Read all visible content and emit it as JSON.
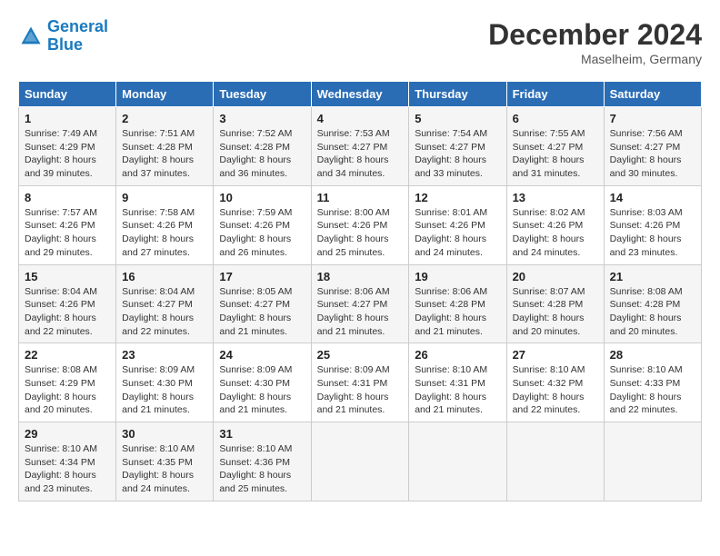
{
  "header": {
    "logo_general": "General",
    "logo_blue": "Blue",
    "month_title": "December 2024",
    "location": "Maselheim, Germany"
  },
  "days_of_week": [
    "Sunday",
    "Monday",
    "Tuesday",
    "Wednesday",
    "Thursday",
    "Friday",
    "Saturday"
  ],
  "weeks": [
    [
      {
        "day": "1",
        "sunrise": "Sunrise: 7:49 AM",
        "sunset": "Sunset: 4:29 PM",
        "daylight": "Daylight: 8 hours and 39 minutes."
      },
      {
        "day": "2",
        "sunrise": "Sunrise: 7:51 AM",
        "sunset": "Sunset: 4:28 PM",
        "daylight": "Daylight: 8 hours and 37 minutes."
      },
      {
        "day": "3",
        "sunrise": "Sunrise: 7:52 AM",
        "sunset": "Sunset: 4:28 PM",
        "daylight": "Daylight: 8 hours and 36 minutes."
      },
      {
        "day": "4",
        "sunrise": "Sunrise: 7:53 AM",
        "sunset": "Sunset: 4:27 PM",
        "daylight": "Daylight: 8 hours and 34 minutes."
      },
      {
        "day": "5",
        "sunrise": "Sunrise: 7:54 AM",
        "sunset": "Sunset: 4:27 PM",
        "daylight": "Daylight: 8 hours and 33 minutes."
      },
      {
        "day": "6",
        "sunrise": "Sunrise: 7:55 AM",
        "sunset": "Sunset: 4:27 PM",
        "daylight": "Daylight: 8 hours and 31 minutes."
      },
      {
        "day": "7",
        "sunrise": "Sunrise: 7:56 AM",
        "sunset": "Sunset: 4:27 PM",
        "daylight": "Daylight: 8 hours and 30 minutes."
      }
    ],
    [
      {
        "day": "8",
        "sunrise": "Sunrise: 7:57 AM",
        "sunset": "Sunset: 4:26 PM",
        "daylight": "Daylight: 8 hours and 29 minutes."
      },
      {
        "day": "9",
        "sunrise": "Sunrise: 7:58 AM",
        "sunset": "Sunset: 4:26 PM",
        "daylight": "Daylight: 8 hours and 27 minutes."
      },
      {
        "day": "10",
        "sunrise": "Sunrise: 7:59 AM",
        "sunset": "Sunset: 4:26 PM",
        "daylight": "Daylight: 8 hours and 26 minutes."
      },
      {
        "day": "11",
        "sunrise": "Sunrise: 8:00 AM",
        "sunset": "Sunset: 4:26 PM",
        "daylight": "Daylight: 8 hours and 25 minutes."
      },
      {
        "day": "12",
        "sunrise": "Sunrise: 8:01 AM",
        "sunset": "Sunset: 4:26 PM",
        "daylight": "Daylight: 8 hours and 24 minutes."
      },
      {
        "day": "13",
        "sunrise": "Sunrise: 8:02 AM",
        "sunset": "Sunset: 4:26 PM",
        "daylight": "Daylight: 8 hours and 24 minutes."
      },
      {
        "day": "14",
        "sunrise": "Sunrise: 8:03 AM",
        "sunset": "Sunset: 4:26 PM",
        "daylight": "Daylight: 8 hours and 23 minutes."
      }
    ],
    [
      {
        "day": "15",
        "sunrise": "Sunrise: 8:04 AM",
        "sunset": "Sunset: 4:26 PM",
        "daylight": "Daylight: 8 hours and 22 minutes."
      },
      {
        "day": "16",
        "sunrise": "Sunrise: 8:04 AM",
        "sunset": "Sunset: 4:27 PM",
        "daylight": "Daylight: 8 hours and 22 minutes."
      },
      {
        "day": "17",
        "sunrise": "Sunrise: 8:05 AM",
        "sunset": "Sunset: 4:27 PM",
        "daylight": "Daylight: 8 hours and 21 minutes."
      },
      {
        "day": "18",
        "sunrise": "Sunrise: 8:06 AM",
        "sunset": "Sunset: 4:27 PM",
        "daylight": "Daylight: 8 hours and 21 minutes."
      },
      {
        "day": "19",
        "sunrise": "Sunrise: 8:06 AM",
        "sunset": "Sunset: 4:28 PM",
        "daylight": "Daylight: 8 hours and 21 minutes."
      },
      {
        "day": "20",
        "sunrise": "Sunrise: 8:07 AM",
        "sunset": "Sunset: 4:28 PM",
        "daylight": "Daylight: 8 hours and 20 minutes."
      },
      {
        "day": "21",
        "sunrise": "Sunrise: 8:08 AM",
        "sunset": "Sunset: 4:28 PM",
        "daylight": "Daylight: 8 hours and 20 minutes."
      }
    ],
    [
      {
        "day": "22",
        "sunrise": "Sunrise: 8:08 AM",
        "sunset": "Sunset: 4:29 PM",
        "daylight": "Daylight: 8 hours and 20 minutes."
      },
      {
        "day": "23",
        "sunrise": "Sunrise: 8:09 AM",
        "sunset": "Sunset: 4:30 PM",
        "daylight": "Daylight: 8 hours and 21 minutes."
      },
      {
        "day": "24",
        "sunrise": "Sunrise: 8:09 AM",
        "sunset": "Sunset: 4:30 PM",
        "daylight": "Daylight: 8 hours and 21 minutes."
      },
      {
        "day": "25",
        "sunrise": "Sunrise: 8:09 AM",
        "sunset": "Sunset: 4:31 PM",
        "daylight": "Daylight: 8 hours and 21 minutes."
      },
      {
        "day": "26",
        "sunrise": "Sunrise: 8:10 AM",
        "sunset": "Sunset: 4:31 PM",
        "daylight": "Daylight: 8 hours and 21 minutes."
      },
      {
        "day": "27",
        "sunrise": "Sunrise: 8:10 AM",
        "sunset": "Sunset: 4:32 PM",
        "daylight": "Daylight: 8 hours and 22 minutes."
      },
      {
        "day": "28",
        "sunrise": "Sunrise: 8:10 AM",
        "sunset": "Sunset: 4:33 PM",
        "daylight": "Daylight: 8 hours and 22 minutes."
      }
    ],
    [
      {
        "day": "29",
        "sunrise": "Sunrise: 8:10 AM",
        "sunset": "Sunset: 4:34 PM",
        "daylight": "Daylight: 8 hours and 23 minutes."
      },
      {
        "day": "30",
        "sunrise": "Sunrise: 8:10 AM",
        "sunset": "Sunset: 4:35 PM",
        "daylight": "Daylight: 8 hours and 24 minutes."
      },
      {
        "day": "31",
        "sunrise": "Sunrise: 8:10 AM",
        "sunset": "Sunset: 4:36 PM",
        "daylight": "Daylight: 8 hours and 25 minutes."
      },
      null,
      null,
      null,
      null
    ]
  ]
}
